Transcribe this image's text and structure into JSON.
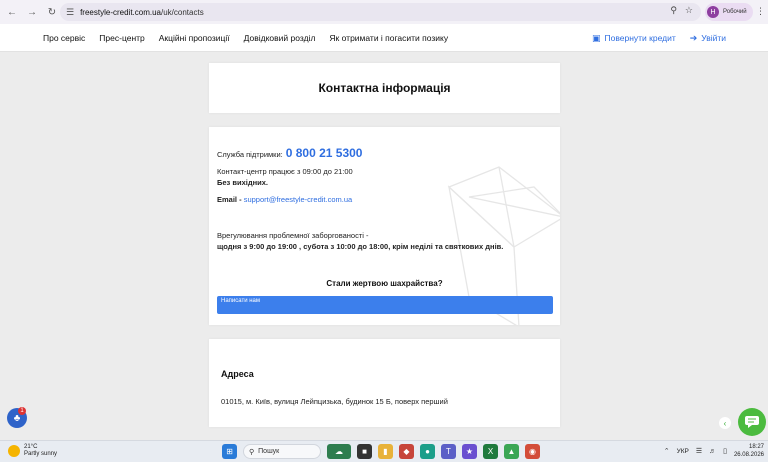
{
  "browser": {
    "url_domain": "freestyle-credit.com.ua",
    "url_path": "/uk/contacts",
    "profile_initial": "Н",
    "profile_label": "Робочий"
  },
  "nav": {
    "items": [
      "Про сервіс",
      "Прес-центр",
      "Акційні пропозиції",
      "Довідковий розділ",
      "Як отримати і погасити позику"
    ],
    "return_credit": "Повернути кредит",
    "login": "Увійти"
  },
  "contact_card": {
    "title": "Контактна інформація"
  },
  "info_card": {
    "support_label": "Служба підтримки:",
    "support_phone": "0 800 21 5300",
    "contact_center": "Контакт-центр працює з 09:00 до 21:00",
    "no_weekends": "Без вихідних.",
    "email_label": "Email - ",
    "email": "support@freestyle-credit.com.ua",
    "debt_label": "Врегулювання проблемної заборгованості -",
    "debt_hours": "щодня з 9:00 до 19:00 , субота з 10:00 до 18:00, крім неділі та святкових днів.",
    "fraud_question": "Стали жертвою шахрайства?",
    "write_button": "Написати нам"
  },
  "address_card": {
    "title": "Адреса",
    "address": "01015, м. Київ, вулиця Лейпцизька, будинок 15 Б, поверх перший"
  },
  "widgets": {
    "bell_badge": "1"
  },
  "taskbar": {
    "temperature": "21°C",
    "weather": "Partly sunny",
    "search_placeholder": "Пошук",
    "lang": "УКР",
    "time": "18:27",
    "date": "26.08.2026"
  },
  "colors": {
    "accent": "#2f6ee0",
    "button": "#3c7fec",
    "chat": "#4cbb3f"
  }
}
